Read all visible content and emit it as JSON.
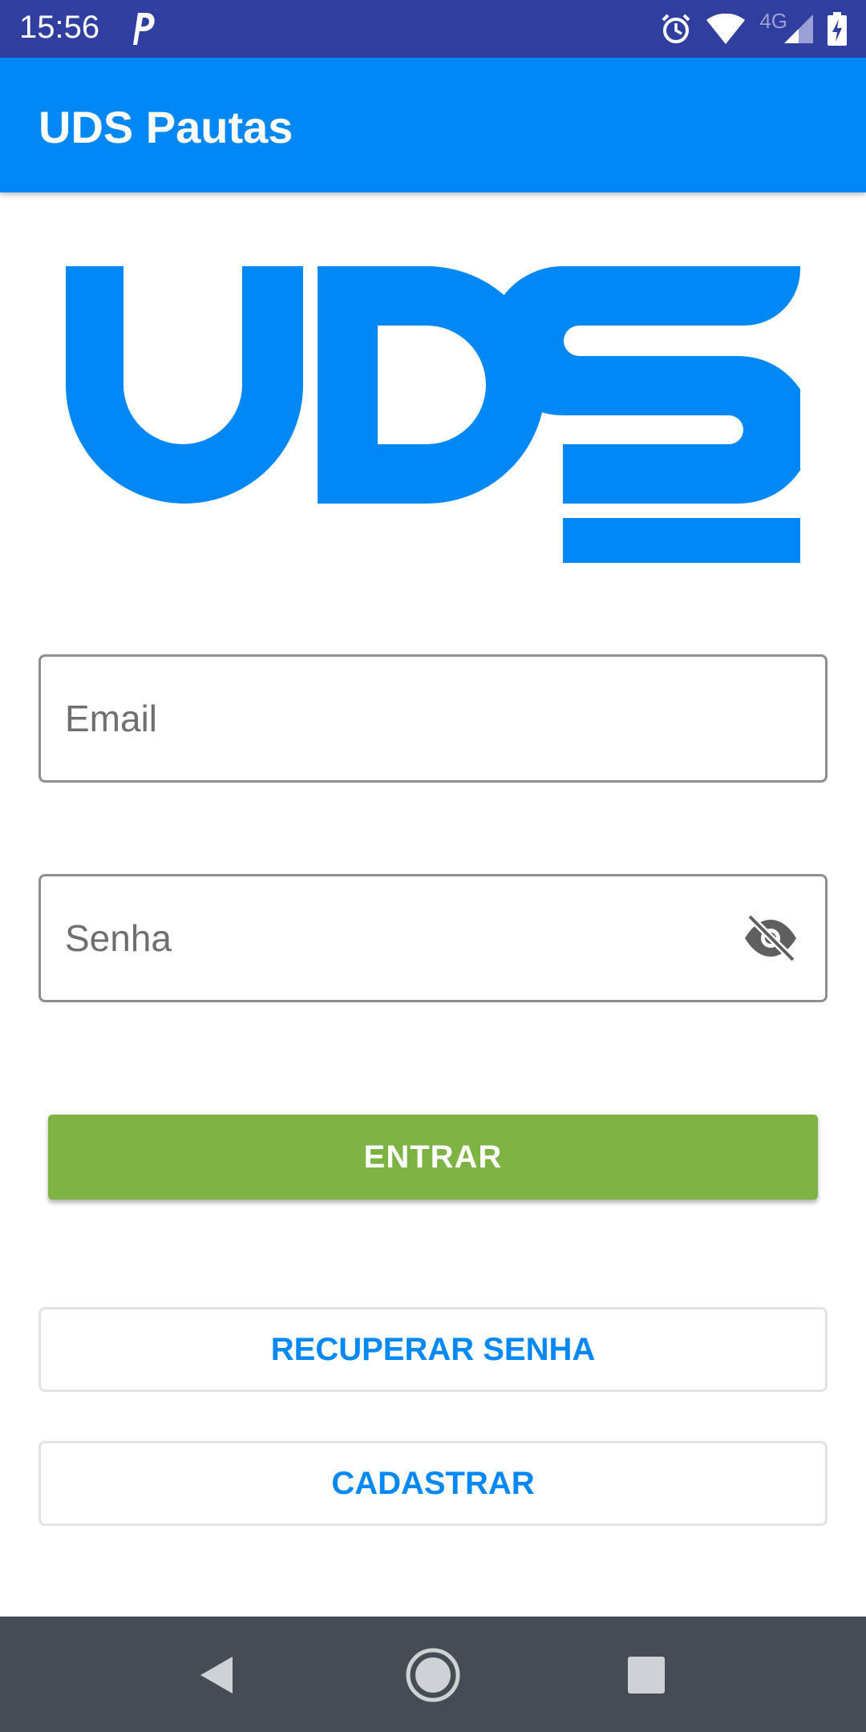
{
  "status_bar": {
    "time": "15:56",
    "network_label": "4G",
    "icons": [
      "parking-p-icon",
      "alarm-icon",
      "wifi-icon",
      "cell-signal-icon",
      "battery-charging-icon"
    ]
  },
  "app_bar": {
    "title": "UDS Pautas",
    "color": "#0288f5"
  },
  "logo": {
    "text": "UDS",
    "color": "#0288f5"
  },
  "form": {
    "email": {
      "placeholder": "Email",
      "value": ""
    },
    "password": {
      "placeholder": "Senha",
      "value": "",
      "toggle_icon": "eye-off-icon"
    }
  },
  "buttons": {
    "login": {
      "label": "ENTRAR",
      "color": "#7cb342"
    },
    "recover": {
      "label": "RECUPERAR SENHA"
    },
    "register": {
      "label": "CADASTRAR"
    }
  },
  "nav_bar": {
    "icons": [
      "back-triangle-icon",
      "home-circle-icon",
      "recents-square-icon"
    ]
  }
}
